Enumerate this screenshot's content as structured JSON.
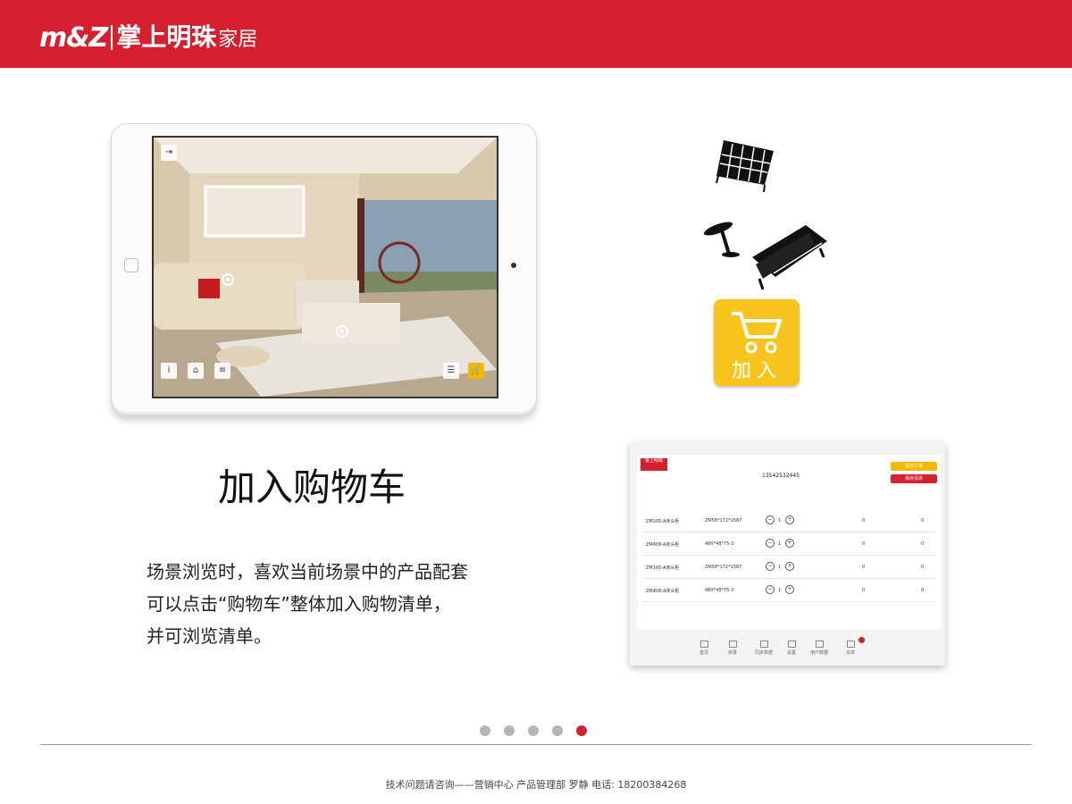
{
  "header": {
    "logo_mark": "m&Z",
    "logo_cn": "掌上明珠",
    "logo_suffix": "家居",
    "bg_color": "#d4202f"
  },
  "ipad_screen": {
    "top_button": "退出",
    "bottom_buttons": [
      "说明",
      "首页",
      "产品信息"
    ],
    "right_buttons": [
      "清单",
      "加入"
    ]
  },
  "cart_tile": {
    "label": "加入",
    "icon": "shopping-cart-icon",
    "bg_color": "#f7c51d"
  },
  "side_icons": [
    "cabinet-icon",
    "side-table-icon",
    "sofa-icon"
  ],
  "headline": "加入购物车",
  "description": [
    "场景浏览时，喜欢当前场景中的产品配套",
    "可以点击“购物车”整体加入购物清单，",
    "并可浏览清单。"
  ],
  "order_panel": {
    "phone": "13542532445",
    "buttons": [
      "提交订单",
      "保存清单"
    ],
    "rows": [
      {
        "code": "ZM105-A床头柜",
        "spec": "ZM58*172*1587",
        "qty": "1",
        "price": "0",
        "subtotal": "0"
      },
      {
        "code": "ZM408-A床头柜",
        "spec": "480*48*75-3",
        "qty": "1",
        "price": "0",
        "subtotal": "0"
      },
      {
        "code": "ZM105-A床头柜",
        "spec": "ZM58*172*1587",
        "qty": "1",
        "price": "0",
        "subtotal": "0"
      },
      {
        "code": "ZM408-A床头柜",
        "spec": "480*48*75-3",
        "qty": "1",
        "price": "0",
        "subtotal": "0"
      }
    ],
    "footer_items": [
      "首页",
      "目录",
      "同步数据",
      "设置",
      "用户数据",
      "清单"
    ]
  },
  "pagination": {
    "total": 5,
    "active": 5
  },
  "footer": "技术问题请咨询——营销中心 产品管理部  罗静 电话: 18200384268"
}
